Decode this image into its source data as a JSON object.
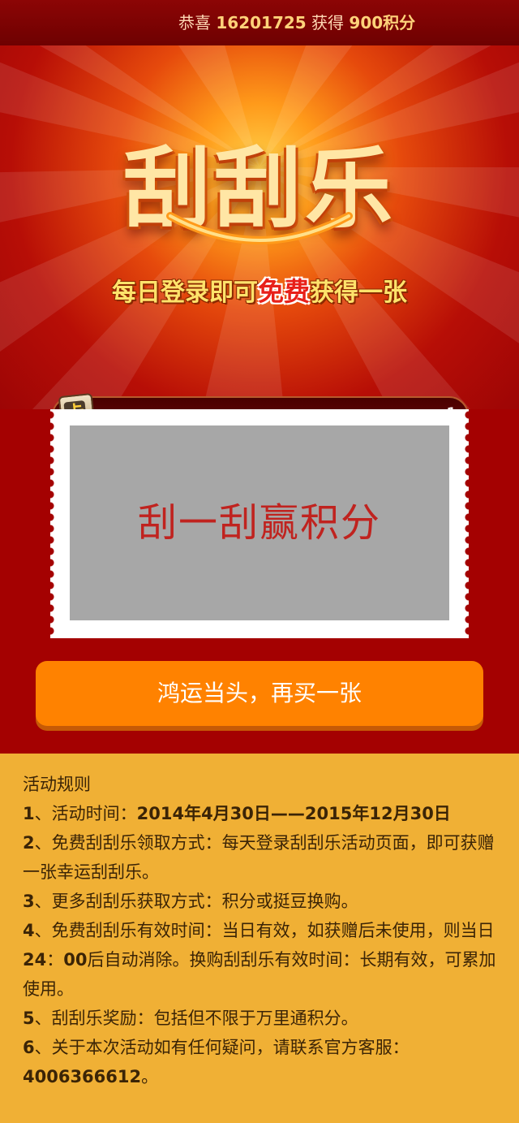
{
  "ticker": {
    "prefix": "恭喜",
    "user": "16201725",
    "middle": "获得",
    "points": "900",
    "suffix": "积分"
  },
  "hero": {
    "logo": "刮刮乐",
    "slogan_part1": "每日登录即可",
    "slogan_free": "免费",
    "slogan_part2": "获得一张",
    "card_icon_text": "卡",
    "count": "1"
  },
  "scratch": {
    "text": "刮一刮赢积分"
  },
  "buy_button": {
    "label": "鸿运当头，再买一张"
  },
  "rules": {
    "title": "活动规则",
    "items": [
      {
        "num": "1",
        "sep": "、",
        "text": "活动时间：",
        "bold": "2014年4月30日——2015年12月30日"
      },
      {
        "num": "2",
        "sep": "、",
        "text": "免费刮刮乐领取方式：每天登录刮刮乐活动页面，即可获赠一张幸运刮刮乐。"
      },
      {
        "num": "3",
        "sep": "、",
        "text": "更多刮刮乐获取方式：积分或挺豆换购。"
      },
      {
        "num": "4",
        "sep": "、",
        "text_a": "免费刮刮乐有效时间：当日有效，如获赠后未使用，则当日",
        "bold_a": "24",
        "text_b": "：",
        "bold_b": "00",
        "text_c": "后自动消除。换购刮刮乐有效时间：长期有效，可累加使用。"
      },
      {
        "num": "5",
        "sep": "、",
        "text": "刮刮乐奖励：包括但不限于万里通积分。"
      },
      {
        "num": "6",
        "sep": "、",
        "text": "关于本次活动如有任何疑问，请联系官方客服：",
        "phone": "4006366612",
        "end": "。"
      }
    ]
  }
}
